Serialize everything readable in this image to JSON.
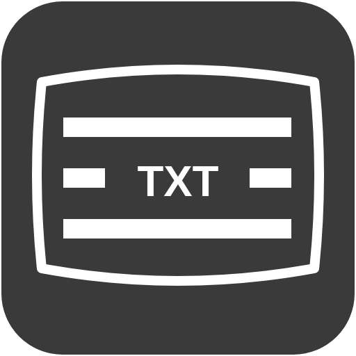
{
  "icon": {
    "name": "teletext-icon",
    "label": "TXT",
    "colors": {
      "background": "#3a3a3a",
      "foreground": "#ffffff"
    }
  }
}
